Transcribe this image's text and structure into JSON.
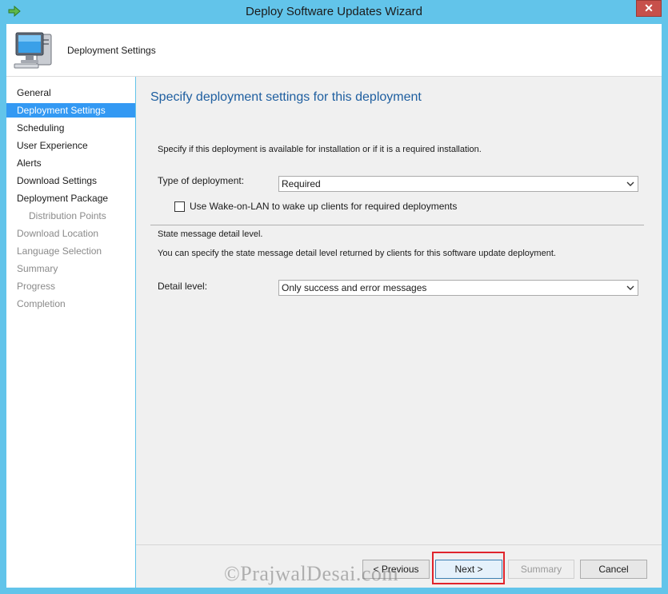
{
  "window": {
    "title": "Deploy Software Updates Wizard",
    "close_glyph": "✕"
  },
  "header": {
    "title": "Deployment Settings",
    "icon": "computer-icon"
  },
  "sidebar": {
    "items": [
      {
        "label": "General",
        "state": "normal"
      },
      {
        "label": "Deployment Settings",
        "state": "active"
      },
      {
        "label": "Scheduling",
        "state": "normal"
      },
      {
        "label": "User Experience",
        "state": "normal"
      },
      {
        "label": "Alerts",
        "state": "normal"
      },
      {
        "label": "Download Settings",
        "state": "normal"
      },
      {
        "label": "Deployment Package",
        "state": "normal"
      },
      {
        "label": "Distribution Points",
        "state": "disabled"
      },
      {
        "label": "Download Location",
        "state": "disabled"
      },
      {
        "label": "Language Selection",
        "state": "disabled"
      },
      {
        "label": "Summary",
        "state": "disabled"
      },
      {
        "label": "Progress",
        "state": "disabled"
      },
      {
        "label": "Completion",
        "state": "disabled"
      }
    ]
  },
  "main": {
    "heading": "Specify deployment settings for this deployment",
    "deployment_desc": "Specify if this deployment is available for installation or if it is a required installation.",
    "type_label": "Type of deployment:",
    "type_value": "Required",
    "wol_label": "Use Wake-on-LAN to wake up clients for required deployments",
    "wol_checked": false,
    "state_msg_heading": "State message detail level.",
    "state_msg_desc": "You can specify the state message detail level returned by clients for this software update deployment.",
    "detail_label": "Detail level:",
    "detail_value": "Only success and error messages"
  },
  "footer": {
    "previous": "< Previous",
    "next": "Next >",
    "summary": "Summary",
    "cancel": "Cancel"
  },
  "watermark": "©PrajwalDesai.com",
  "colors": {
    "accent": "#3399f3",
    "titlebar": "#62c4ea",
    "heading": "#1f5fa0",
    "highlight": "#e0242b"
  }
}
